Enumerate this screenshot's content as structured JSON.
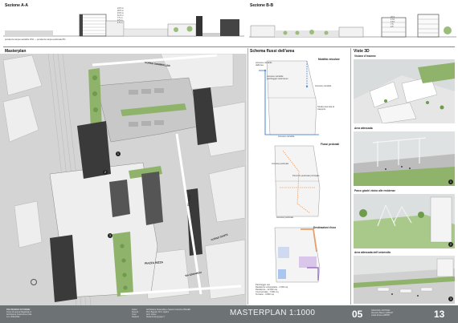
{
  "sections": {
    "a_title": "Sezione A-A",
    "b_title": "Sezione B-B",
    "a_levels": [
      "24.5 m",
      "20.5 m",
      "15.5 m",
      "11.5 m",
      "7.5 m",
      "4.5 m",
      "1.5 m"
    ],
    "b_levels": [
      "20.5",
      "17.0",
      "13.0",
      "7.5",
      "4.5"
    ],
    "a_notes": [
      "pendenza rampa carrabile 15%",
      "pendenza rampa pedonale 8%"
    ]
  },
  "masterplan": {
    "title": "Masterplan",
    "streets": [
      "CORSO SOMMEILLER",
      "VIA NIZZA",
      "CORSO DANTE",
      "PIAZZA NIZZA",
      "VIA EDOARDO"
    ],
    "markers": [
      "1",
      "2",
      "3"
    ]
  },
  "schema": {
    "title": "Schema flussi dell'area",
    "panels": [
      {
        "label": "Mobilità veicolare",
        "notes": [
          "Accesso carrabile dall'area",
          "Accesso carrabile parcheggio sotterraneo",
          "Accesso carrabile",
          "Strada riservata al trasporto",
          "Accesso carrabile"
        ]
      },
      {
        "label": "Flussi pedonali",
        "notes": [
          "Accesso pedonale",
          "Percorso pedonale principale",
          "Accesso pedonale"
        ]
      },
      {
        "label": "Destinazioni d'uso",
        "notes": [
          "Parcheggio uso",
          "Residenze universitarie - 1.500 mq",
          "Residenze - 12.000 mq",
          "Commerciale - 7.500 mq",
          "Terziario - 3.800 mq"
        ]
      }
    ]
  },
  "viste": {
    "title": "Viste 3D",
    "items": [
      {
        "label": "Visione d'insieme",
        "marker": ""
      },
      {
        "label": "Area attrezzata",
        "marker": "1"
      },
      {
        "label": "Parco giochi vicino alle residenze",
        "marker": "2"
      },
      {
        "label": "Area attrezzata dell'università",
        "marker": "3"
      }
    ]
  },
  "footer": {
    "school": [
      "POLITECNICO DI TORINO",
      "Corso di Laurea Magistrale in",
      "Architettura Costruzione Città",
      "A.A. 2021/2022"
    ],
    "meta": [
      "Atelier",
      "Docenti",
      "Tutor",
      "Studenti"
    ],
    "meta_values": [
      "Architettura Sostenibile e Spazio Costruito ATELIER",
      "Prof. Bagnoli, Prof. Ugolini",
      "Arch. Rossi",
      "Studenti del gruppo 3"
    ],
    "title": "MASTERPLAN 1:1000",
    "group": "05",
    "table_number": "13",
    "credits": [
      "NATALINA, ANTONIO",
      "Riccardo Bianco s284647",
      "Giulia Rossa s285557"
    ]
  },
  "colors": {
    "footer_bg": "#6d7275",
    "green_areas": "#8fb36a",
    "buildings": "#3a3a3a",
    "blue_flow": "#5a8fd6",
    "orange_use": "#e7a06b"
  }
}
